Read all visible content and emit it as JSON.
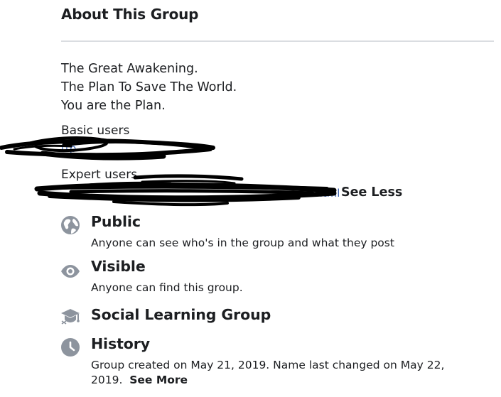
{
  "section": {
    "title": "About This Group"
  },
  "description": {
    "lines": [
      "The Great Awakening.",
      "The Plan To Save The World.",
      "You are the Plan."
    ]
  },
  "basic_users": {
    "label": "Basic users",
    "link_fragment": "ttp"
  },
  "expert_users": {
    "label": "Expert users",
    "link_fragment": "3.html",
    "see_less": "See Less"
  },
  "rows": {
    "public": {
      "title": "Public",
      "subtitle": "Anyone can see who's in the group and what they post",
      "icon": "globe-icon"
    },
    "visible": {
      "title": "Visible",
      "subtitle": "Anyone can find this group.",
      "icon": "eye-icon"
    },
    "social": {
      "title": "Social Learning Group",
      "icon": "graduation-cap-icon"
    },
    "history": {
      "title": "History",
      "subtitle": "Group created on May 21, 2019. Name last changed on May 22, 2019.",
      "see_more": "See More",
      "icon": "clock-icon"
    }
  },
  "colors": {
    "text": "#1c1e21",
    "icon": "#8d949e",
    "link": "#4267b2",
    "divider": "#dadde1"
  }
}
